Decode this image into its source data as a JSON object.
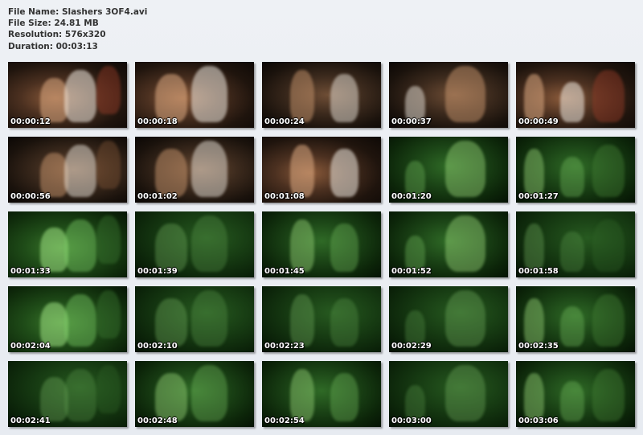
{
  "file_info": {
    "name_line": "File Name: Slashers 3OF4.avi",
    "size_line": "File Size: 24.81 MB",
    "resolution_line": "Resolution: 576x320",
    "duration_line": "Duration: 00:03:13"
  },
  "thumbnails": [
    {
      "timestamp": "00:00:12",
      "tone": "warm"
    },
    {
      "timestamp": "00:00:18",
      "tone": "warm"
    },
    {
      "timestamp": "00:00:24",
      "tone": "warm2"
    },
    {
      "timestamp": "00:00:37",
      "tone": "warm2"
    },
    {
      "timestamp": "00:00:49",
      "tone": "warm"
    },
    {
      "timestamp": "00:00:56",
      "tone": "warm2"
    },
    {
      "timestamp": "00:01:02",
      "tone": "warm2"
    },
    {
      "timestamp": "00:01:08",
      "tone": "warm"
    },
    {
      "timestamp": "00:01:20",
      "tone": "green"
    },
    {
      "timestamp": "00:01:27",
      "tone": "green"
    },
    {
      "timestamp": "00:01:33",
      "tone": "green2"
    },
    {
      "timestamp": "00:01:39",
      "tone": "green3"
    },
    {
      "timestamp": "00:01:45",
      "tone": "green"
    },
    {
      "timestamp": "00:01:52",
      "tone": "green"
    },
    {
      "timestamp": "00:01:58",
      "tone": "green3"
    },
    {
      "timestamp": "00:02:04",
      "tone": "green2"
    },
    {
      "timestamp": "00:02:10",
      "tone": "green3"
    },
    {
      "timestamp": "00:02:23",
      "tone": "green3"
    },
    {
      "timestamp": "00:02:29",
      "tone": "green3"
    },
    {
      "timestamp": "00:02:35",
      "tone": "green"
    },
    {
      "timestamp": "00:02:41",
      "tone": "green3"
    },
    {
      "timestamp": "00:02:48",
      "tone": "green"
    },
    {
      "timestamp": "00:02:54",
      "tone": "green"
    },
    {
      "timestamp": "00:03:00",
      "tone": "green3"
    },
    {
      "timestamp": "00:03:06",
      "tone": "green"
    }
  ]
}
